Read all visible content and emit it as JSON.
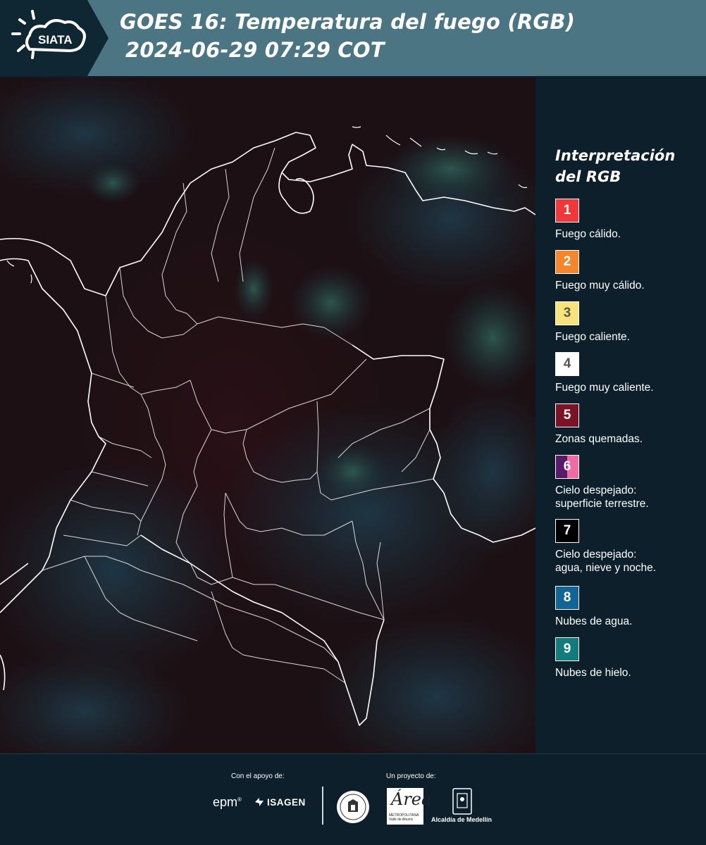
{
  "header": {
    "logo_text": "SIATA",
    "title_line1": "GOES 16: Temperatura del fuego (RGB)",
    "title_line2": "2024-06-29 07:29 COT"
  },
  "legend": {
    "title_line1": "Interpretación",
    "title_line2": "del RGB",
    "items": [
      {
        "number": "1",
        "label": "Fuego cálido.",
        "color": "#f0373a"
      },
      {
        "number": "2",
        "label": "Fuego muy cálido.",
        "color": "#f5862d"
      },
      {
        "number": "3",
        "label": "Fuego caliente.",
        "color": "#f7e27b"
      },
      {
        "number": "4",
        "label": "Fuego muy caliente.",
        "color": "#ffffff"
      },
      {
        "number": "5",
        "label": "Zonas quemadas.",
        "color": "#7c1226"
      },
      {
        "number": "6",
        "label_line1": "Cielo despejado:",
        "label_line2": "superficie terrestre.",
        "color": "#5a1a6b",
        "color_right": "#f06aa3"
      },
      {
        "number": "7",
        "label_line1": "Cielo despejado:",
        "label_line2": "agua, nieve y noche.",
        "color": "#000000"
      },
      {
        "number": "8",
        "label": "Nubes de agua.",
        "color": "#126496"
      },
      {
        "number": "9",
        "label": "Nubes de hielo.",
        "color": "#137b7c"
      }
    ]
  },
  "footer": {
    "support_label": "Con el apoyo de:",
    "project_label": "Un proyecto de:",
    "epm": "epm",
    "isagen": "ISAGEN",
    "area_letter": "Área",
    "area_sub1": "METROPOLITANA",
    "area_sub2": "Valle de Aburrá",
    "alcaldia": "Alcaldía de Medellín"
  }
}
